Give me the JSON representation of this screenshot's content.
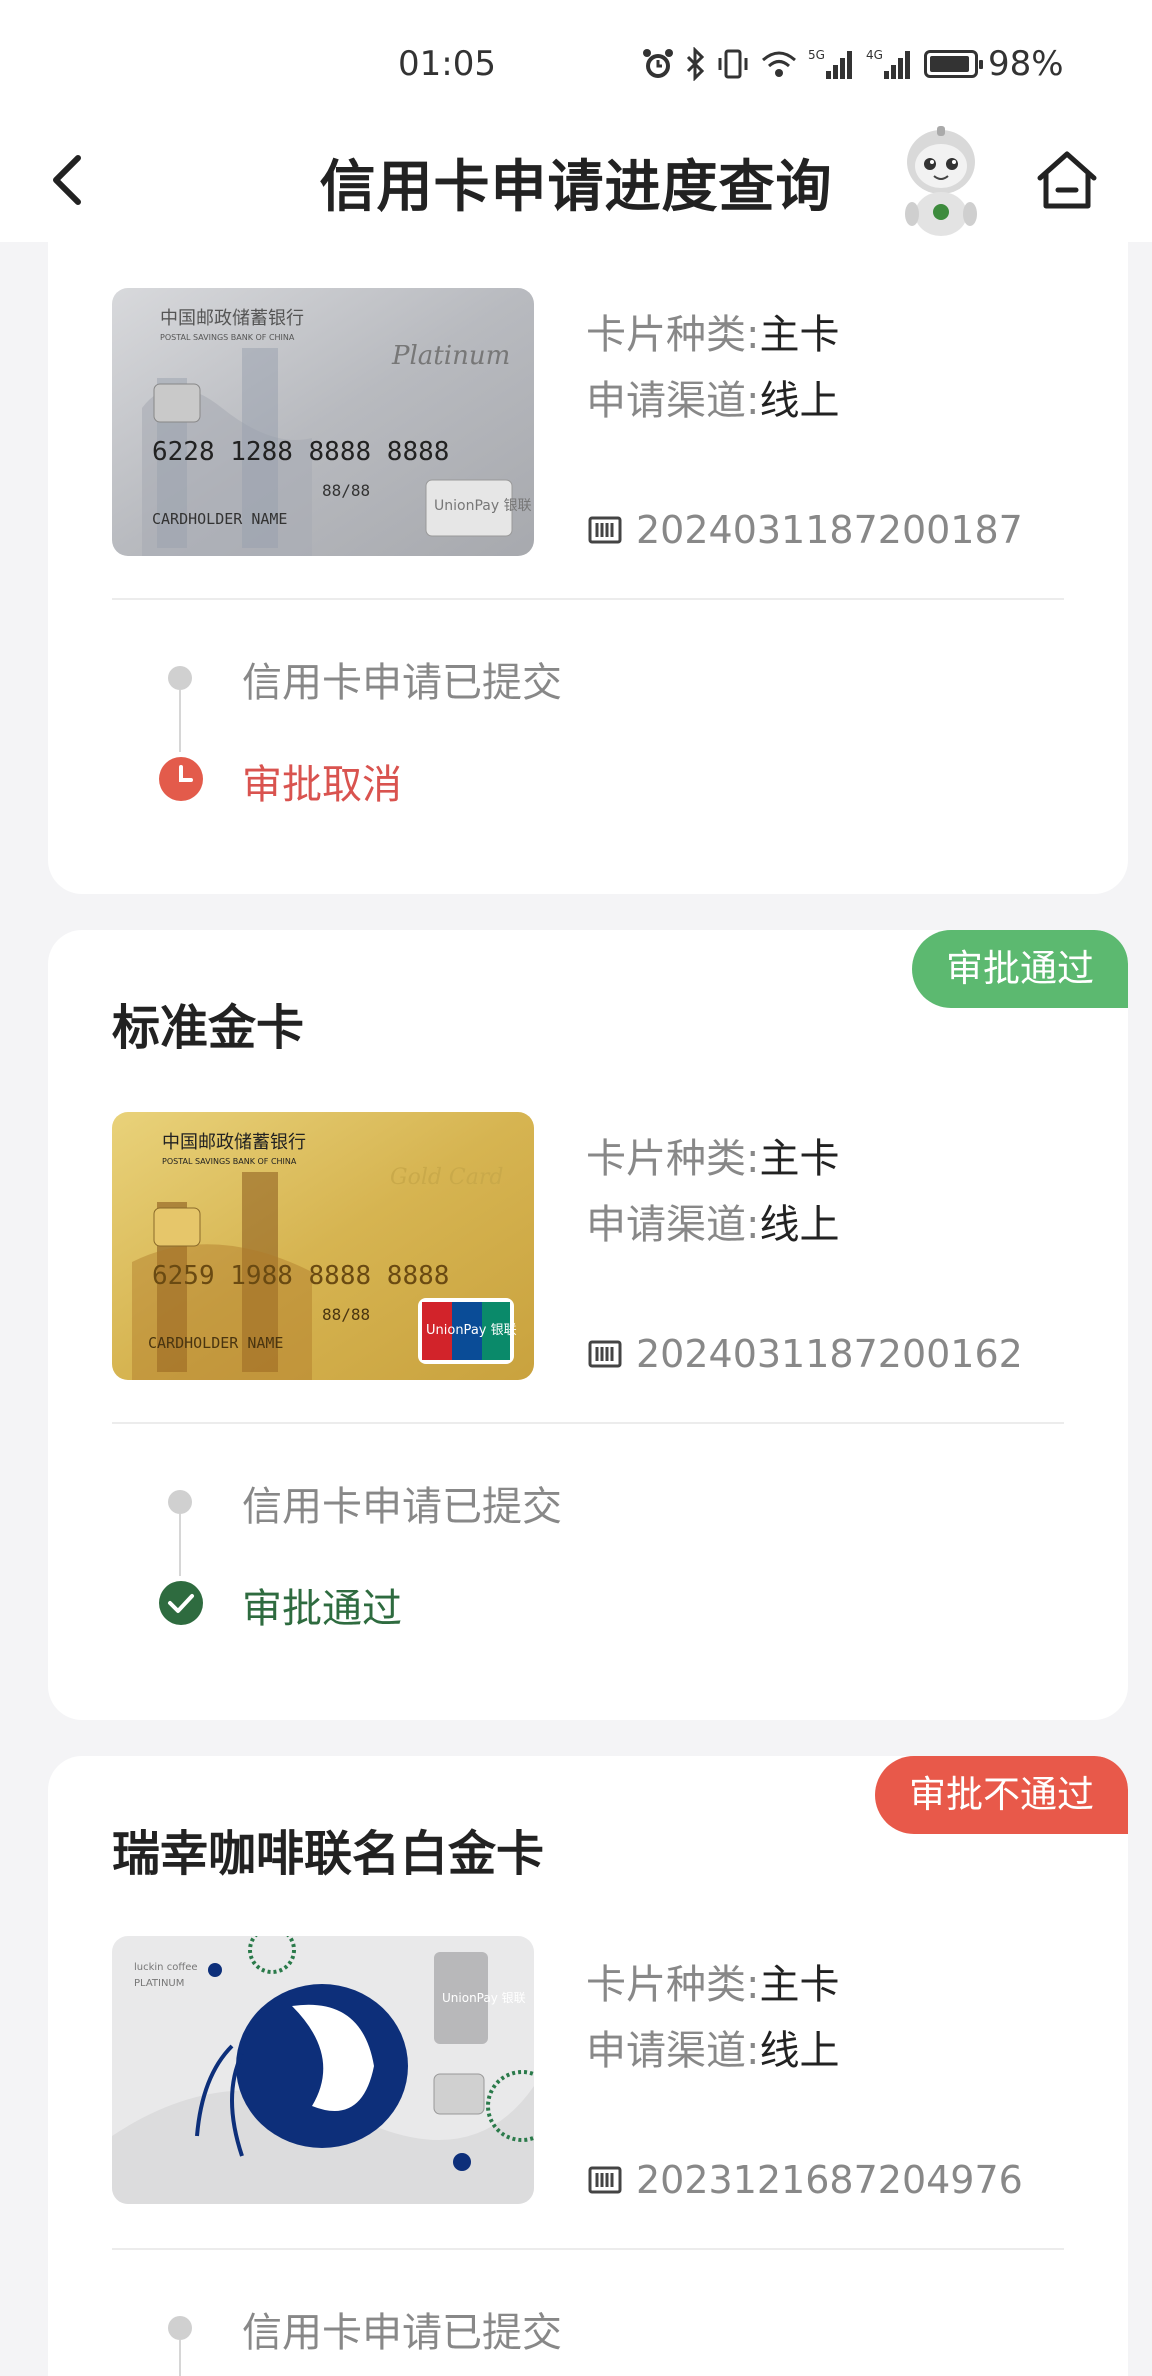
{
  "status_bar": {
    "time": "01:05",
    "battery_percent": "98%",
    "icons": [
      "alarm-icon",
      "bluetooth-icon",
      "vibrate-icon",
      "wifi-icon",
      "5g-signal-icon",
      "4g-signal-icon",
      "battery-icon"
    ]
  },
  "header": {
    "title": "信用卡申请进度查询",
    "icons": [
      "back-arrow-icon",
      "mascot-avatar",
      "home-icon"
    ]
  },
  "colors": {
    "approved_green": "#5cb970",
    "approved_text_green": "#2e6b3f",
    "rejected_red": "#e8594a",
    "cancel_red": "#d9534f"
  },
  "applications": [
    {
      "title": "",
      "card_face": {
        "bank_name": "中国邮政储蓄银行",
        "bank_name_en": "POSTAL SAVINGS BANK OF CHINA",
        "tier": "Platinum",
        "card_number": "6228 1288 8888 8888",
        "holder": "CARDHOLDER NAME",
        "expiry": "88/88",
        "network": "UnionPay 银联"
      },
      "card_type_label": "卡片种类:",
      "card_type_value": "主卡",
      "channel_label": "申请渠道:",
      "channel_value": "线上",
      "application_number": "2024031187200187",
      "timeline": [
        {
          "text": "信用卡申请已提交",
          "state": "done"
        },
        {
          "text": "审批取消",
          "state": "cancelled"
        }
      ]
    },
    {
      "title": "标准金卡",
      "badge": "审批通过",
      "card_face": {
        "bank_name": "中国邮政储蓄银行",
        "bank_name_en": "POSTAL SAVINGS BANK OF CHINA",
        "tier": "Gold Card",
        "card_number": "6259 1988 8888 8888",
        "holder": "CARDHOLDER NAME",
        "expiry": "88/88",
        "network": "UnionPay 银联"
      },
      "card_type_label": "卡片种类:",
      "card_type_value": "主卡",
      "channel_label": "申请渠道:",
      "channel_value": "线上",
      "application_number": "2024031187200162",
      "timeline": [
        {
          "text": "信用卡申请已提交",
          "state": "done"
        },
        {
          "text": "审批通过",
          "state": "approved"
        }
      ]
    },
    {
      "title": "瑞幸咖啡联名白金卡",
      "badge": "审批不通过",
      "card_face": {
        "brand": "luckin coffee",
        "tier": "PLATINUM",
        "network": "UnionPay 银联"
      },
      "card_type_label": "卡片种类:",
      "card_type_value": "主卡",
      "channel_label": "申请渠道:",
      "channel_value": "线上",
      "application_number": "2023121687204976",
      "timeline": [
        {
          "text": "信用卡申请已提交",
          "state": "done"
        }
      ]
    }
  ]
}
